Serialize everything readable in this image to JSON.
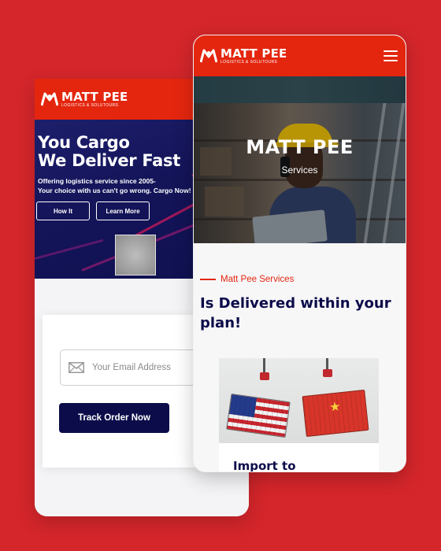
{
  "brand": {
    "name": "MATT PEE",
    "tagline": "LOGISTICS & SOLUTOURS",
    "accent": "#e4260f",
    "navy": "#0c0c4a",
    "background": "#d4262b"
  },
  "back_phone": {
    "hero": {
      "title_line1": "You Cargo",
      "title_line2": "We Deliver Fast",
      "subtitle_line1": "Offering logistics service since 2005-",
      "subtitle_line2": "Your choice with us can't go wrong. Cargo Now!",
      "how_button": "How It",
      "learn_button": "Learn More"
    },
    "track": {
      "email_placeholder": "Your Email Address",
      "track_button": "Track Order Now"
    }
  },
  "front_phone": {
    "menu_icon": "hamburger-menu-icon",
    "hero": {
      "title": "MATT PEE",
      "subtitle": "Services"
    },
    "section": {
      "eyebrow": "Matt Pee Services",
      "title": "Is Delivered within your plan!"
    },
    "service_card": {
      "title": "Import to"
    }
  }
}
